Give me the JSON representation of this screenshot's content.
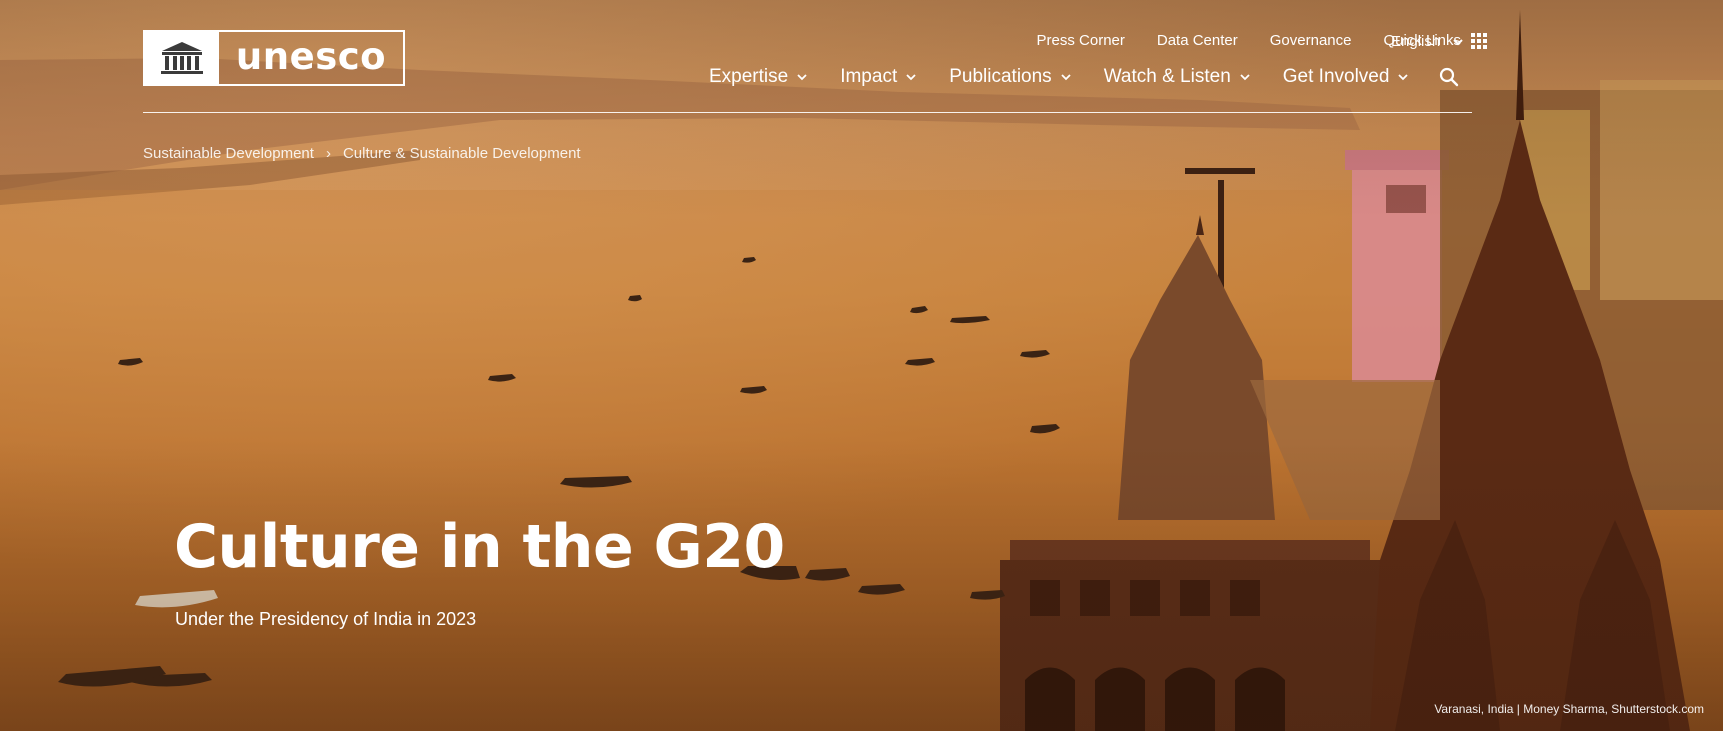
{
  "header": {
    "logo_text": "unesco",
    "utility_links": [
      "Press Corner",
      "Data Center",
      "Governance"
    ],
    "quick_links_label": "Quick Links",
    "language_label": "English",
    "main_nav": [
      "Expertise",
      "Impact",
      "Publications",
      "Watch & Listen",
      "Get Involved"
    ],
    "search_icon": "search-icon"
  },
  "breadcrumb": {
    "items": [
      "Sustainable Development",
      "Culture & Sustainable Development"
    ],
    "separator": "›"
  },
  "hero": {
    "title": "Culture in the G20",
    "subtitle": "Under the Presidency of India in 2023",
    "photo_credit": "Varanasi, India | Money Sharma, Shutterstock.com"
  },
  "colors": {
    "text": "#ffffff",
    "hero_tint_light": "#c78a52",
    "hero_tint_dark": "#7a4117",
    "temple": "#5a2a14",
    "pink_tower": "#d98a8f"
  }
}
